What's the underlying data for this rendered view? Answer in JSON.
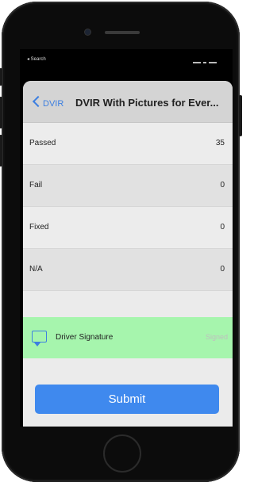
{
  "status_bar": {
    "back_label": "◂ Search"
  },
  "nav": {
    "back_label": "DVIR",
    "title": "DVIR With Pictures for Ever..."
  },
  "rows": [
    {
      "label": "Passed",
      "value": "35"
    },
    {
      "label": "Fail",
      "value": "0"
    },
    {
      "label": "Fixed",
      "value": "0"
    },
    {
      "label": "N/A",
      "value": "0"
    }
  ],
  "signature": {
    "icon": "comment-icon",
    "label": "Driver Signature",
    "status": "Signed"
  },
  "footer": {
    "submit_label": "Submit"
  },
  "colors": {
    "accent": "#3f89ee",
    "signature_bg": "#a6f5ad",
    "nav_bg": "#d4d4d4"
  }
}
